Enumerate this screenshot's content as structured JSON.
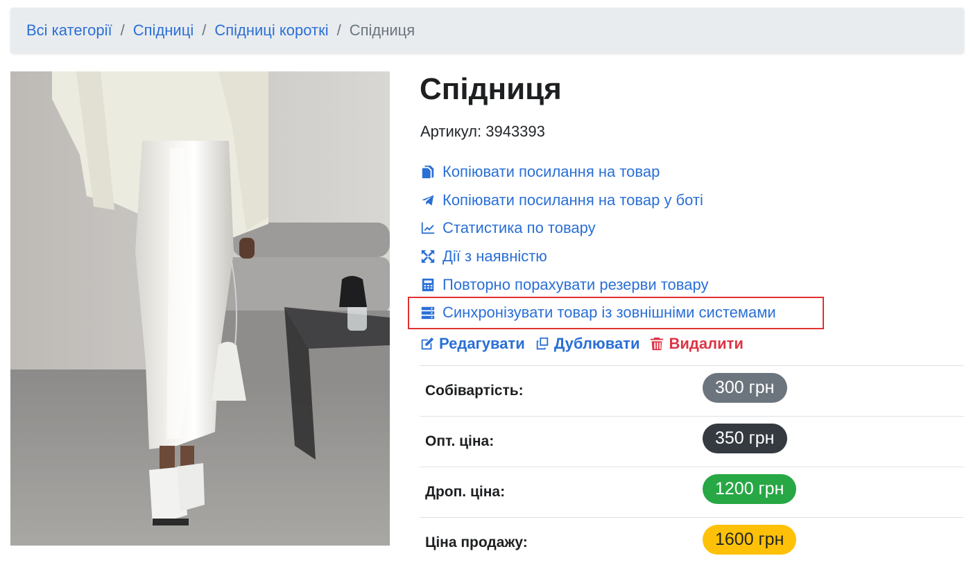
{
  "breadcrumb": {
    "items": [
      "Всі категорії",
      "Спідниці",
      "Спідниці короткі"
    ],
    "separator": "/",
    "current": "Спідниця"
  },
  "product": {
    "title": "Спідниця",
    "sku": "Артикул: 3943393"
  },
  "actions": [
    {
      "label": "Копіювати посилання на товар",
      "icon": "copy-icon"
    },
    {
      "label": "Копіювати посилання на товар у боті",
      "icon": "telegram-icon"
    },
    {
      "label": "Статистика по товару",
      "icon": "chart-line-icon"
    },
    {
      "label": "Дії з наявністю",
      "icon": "expand-arrows-icon"
    },
    {
      "label": "Повторно порахувати резерви товару",
      "icon": "calculator-icon"
    },
    {
      "label": "Синхронізувати товар із зовнішніми системами",
      "icon": "server-icon"
    }
  ],
  "edit_row": {
    "edit_label": "Редагувати",
    "duplicate_label": "Дублювати",
    "delete_label": "Видалити"
  },
  "prices": [
    {
      "label": "Собівартість:",
      "value": "300 грн",
      "color": "#6c757d"
    },
    {
      "label": "Опт. ціна:",
      "value": "350 грн",
      "color": "#343a40"
    },
    {
      "label": "Дроп. ціна:",
      "value": "1200 грн",
      "color": "#28a745"
    },
    {
      "label": "Ціна продажу:",
      "value": "1600 грн",
      "color": "#ffc107"
    }
  ],
  "colors": {
    "link": "#2a6fd6",
    "danger": "#dc3545",
    "highlight": "#e03131",
    "breadcrumb_bg": "#e9ecef"
  }
}
